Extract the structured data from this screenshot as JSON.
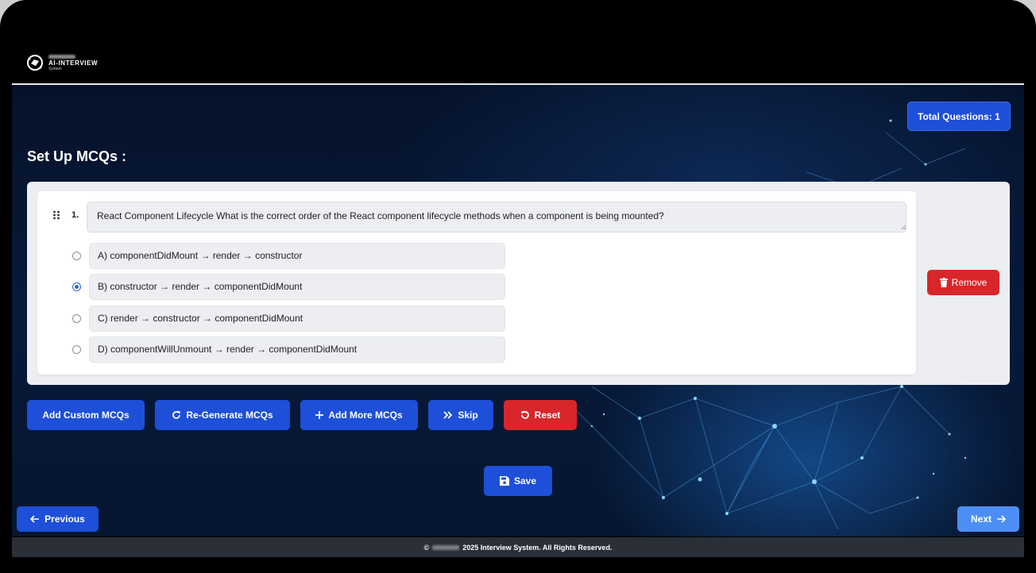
{
  "header": {
    "logo_name": "AI-INTERVIEW",
    "logo_sub": "System"
  },
  "total_questions_label": "Total Questions: 1",
  "section_title": "Set Up MCQs :",
  "question": {
    "number": "1.",
    "text": "React Component Lifecycle What is the correct order of the React component lifecycle methods when a component is being mounted?",
    "options": [
      {
        "label": "A) componentDidMount → render → constructor",
        "selected": false
      },
      {
        "label": "B) constructor → render → componentDidMount",
        "selected": true
      },
      {
        "label": "C) render → constructor → componentDidMount",
        "selected": false
      },
      {
        "label": "D) componentWillUnmount → render → componentDidMount",
        "selected": false
      }
    ],
    "remove_label": "Remove"
  },
  "actions": {
    "add_custom": "Add Custom MCQs",
    "regenerate": "Re-Generate MCQs",
    "add_more": "Add More MCQs",
    "skip": "Skip",
    "reset": "Reset"
  },
  "save_label": "Save",
  "nav": {
    "previous": "Previous",
    "next": "Next"
  },
  "footer": {
    "copyright_symbol": "©",
    "text": "2025 Interview System. All Rights Reserved."
  },
  "colors": {
    "primary": "#1d4fd8",
    "danger": "#d8262a",
    "next_button": "#4d8ef5",
    "footer_bg": "#2b3038"
  }
}
